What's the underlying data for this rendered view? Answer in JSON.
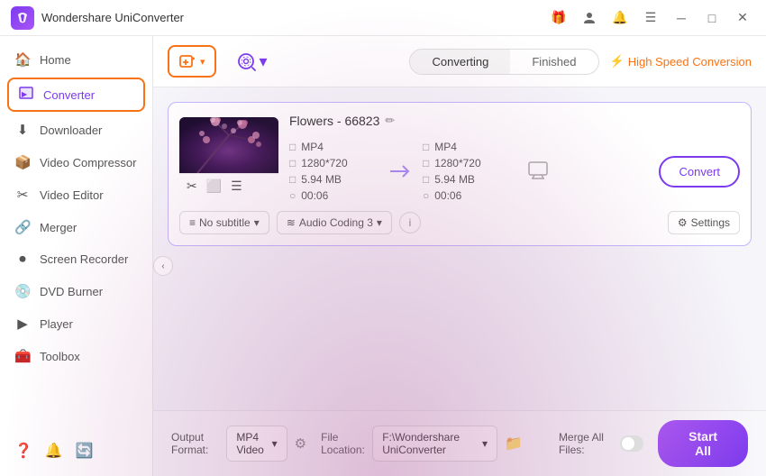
{
  "app": {
    "title": "Wondershare UniConverter",
    "logo_letter": "W"
  },
  "title_bar": {
    "controls": [
      "gift-icon",
      "user-icon",
      "bell-icon",
      "menu-icon",
      "minimize-icon",
      "maximize-icon",
      "close-icon"
    ]
  },
  "sidebar": {
    "items": [
      {
        "id": "home",
        "label": "Home",
        "icon": "🏠"
      },
      {
        "id": "converter",
        "label": "Converter",
        "icon": "🔄",
        "active": true
      },
      {
        "id": "downloader",
        "label": "Downloader",
        "icon": "⬇"
      },
      {
        "id": "video-compressor",
        "label": "Video Compressor",
        "icon": "📦"
      },
      {
        "id": "video-editor",
        "label": "Video Editor",
        "icon": "✂"
      },
      {
        "id": "merger",
        "label": "Merger",
        "icon": "🔗"
      },
      {
        "id": "screen-recorder",
        "label": "Screen Recorder",
        "icon": "⏺"
      },
      {
        "id": "dvd-burner",
        "label": "DVD Burner",
        "icon": "💿"
      },
      {
        "id": "player",
        "label": "Player",
        "icon": "▶"
      },
      {
        "id": "toolbox",
        "label": "Toolbox",
        "icon": "🧰"
      }
    ],
    "bottom_icons": [
      "help-icon",
      "bell-icon",
      "history-icon"
    ]
  },
  "toolbar": {
    "add_file_label": "+",
    "add_dvd_label": "",
    "tabs": [
      {
        "id": "converting",
        "label": "Converting",
        "active": true
      },
      {
        "id": "finished",
        "label": "Finished",
        "active": false
      }
    ],
    "high_speed_label": "High Speed Conversion"
  },
  "file_card": {
    "title": "Flowers - 66823",
    "edit_icon": "✏",
    "source": {
      "format": "MP4",
      "resolution": "1280*720",
      "size": "5.94 MB",
      "duration": "00:06"
    },
    "target": {
      "format": "MP4",
      "resolution": "1280*720",
      "size": "5.94 MB",
      "duration": "00:06"
    },
    "convert_btn_label": "Convert",
    "subtitle_label": "No subtitle",
    "audio_label": "Audio Coding 3",
    "settings_label": "Settings"
  },
  "bottom_bar": {
    "output_format_label": "Output Format:",
    "output_format_value": "MP4 Video",
    "file_location_label": "File Location:",
    "file_location_value": "F:\\Wondershare UniConverter",
    "merge_files_label": "Merge All Files:",
    "start_all_label": "Start All"
  }
}
